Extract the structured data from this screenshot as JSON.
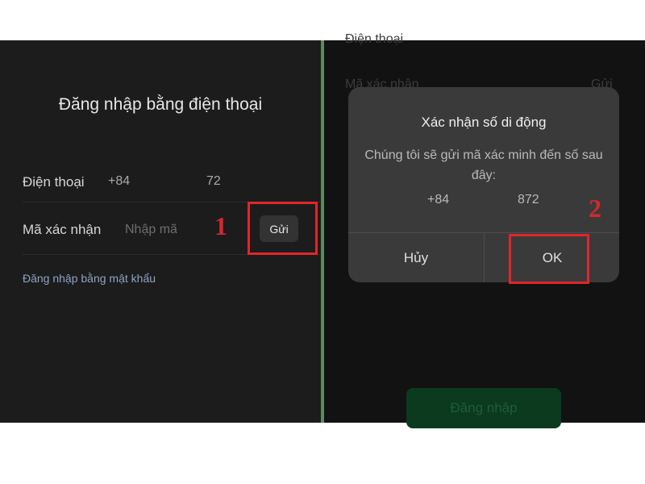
{
  "left": {
    "title": "Đăng nhập bằng điện thoại",
    "phone_label": "Điện thoại",
    "phone_prefix": "+84",
    "phone_suffix": "72",
    "code_label": "Mã xác nhận",
    "code_placeholder": "Nhập mã",
    "send_label": "Gửi",
    "password_link": "Đăng nhập bằng mật khẩu",
    "annotation": "1"
  },
  "right": {
    "bg_phone_label": "Điện thoại",
    "bg_code_label": "Mã xác nhận",
    "bg_send_label": "Gửi",
    "login_label": "Đăng nhập",
    "annotation": "2",
    "dialog": {
      "title": "Xác nhận số di động",
      "message": "Chúng tôi sẽ gửi mã xác minh đến số sau đây:",
      "number_prefix": "+84",
      "number_suffix": "872",
      "cancel_label": "Hủy",
      "ok_label": "OK"
    }
  },
  "colors": {
    "annotation_red": "#e0262a",
    "panel_bg": "#1c1c1c",
    "dialog_bg": "#3a3a3a"
  }
}
